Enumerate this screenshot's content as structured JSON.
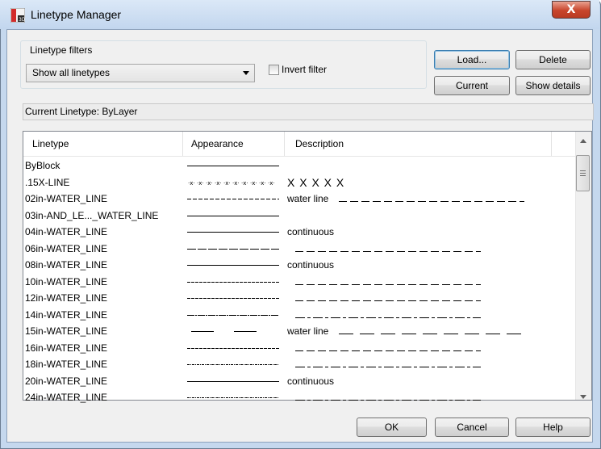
{
  "window": {
    "title": "Linetype Manager",
    "close_label": "X"
  },
  "filters": {
    "group_label": "Linetype filters",
    "selected": "Show all linetypes",
    "invert_label": "Invert filter",
    "invert_checked": false
  },
  "buttons": {
    "load": "Load...",
    "delete": "Delete",
    "current": "Current",
    "show_details": "Show details",
    "ok": "OK",
    "cancel": "Cancel",
    "help": "Help"
  },
  "current_linetype": {
    "label": "Current Linetype:",
    "value": "ByLayer"
  },
  "table": {
    "columns": [
      "Linetype",
      "Appearance",
      "Description"
    ],
    "rows": [
      {
        "name": "ByBlock",
        "appearance": "continuous",
        "description": ""
      },
      {
        "name": ".15X-LINE",
        "appearance": "x-pattern",
        "description": "X  X  X  X  X"
      },
      {
        "name": "02in-WATER_LINE",
        "appearance": "short-dash",
        "description": "water line"
      },
      {
        "name": "03in-AND_LE..._WATER_LINE",
        "appearance": "continuous",
        "description": ""
      },
      {
        "name": "04in-WATER_LINE",
        "appearance": "continuous",
        "description": "continuous"
      },
      {
        "name": "06in-WATER_LINE",
        "appearance": "long-dash",
        "description": ""
      },
      {
        "name": "08in-WATER_LINE",
        "appearance": "continuous",
        "description": "continuous"
      },
      {
        "name": "10in-WATER_LINE",
        "appearance": "fine-dash",
        "description": ""
      },
      {
        "name": "12in-WATER_LINE",
        "appearance": "fine-dash",
        "description": ""
      },
      {
        "name": "14in-WATER_LINE",
        "appearance": "dash",
        "description": ""
      },
      {
        "name": "15in-WATER_LINE",
        "appearance": "gap-dash",
        "description": "water line"
      },
      {
        "name": "16in-WATER_LINE",
        "appearance": "fine-dash",
        "description": ""
      },
      {
        "name": "18in-WATER_LINE",
        "appearance": "dot-dash",
        "description": ""
      },
      {
        "name": "20in-WATER_LINE",
        "appearance": "continuous",
        "description": "continuous"
      },
      {
        "name": "24in-WATER_LINE",
        "appearance": "dot-dash",
        "description": ""
      }
    ]
  }
}
